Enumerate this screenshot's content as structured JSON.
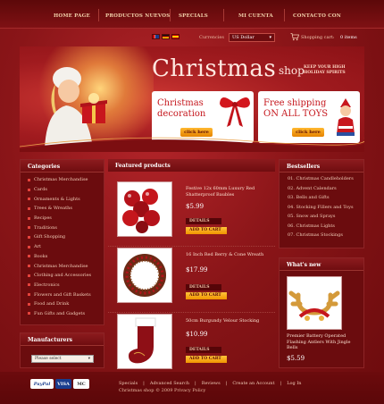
{
  "nav": [
    "HOME PAGE",
    "PRODUCTOS NUEVOS",
    "SPECIALS",
    "MI CUENTA",
    "CONTACTO CON"
  ],
  "currency": {
    "label": "Currencies",
    "value": "US Dollar"
  },
  "cart": {
    "label": "Shopping cart:",
    "items": "0 items"
  },
  "banner": {
    "title": "Christmas",
    "title_suffix": "shop",
    "tagline": "KEEP YOUR HIGH HOLIDAY SPIRITS",
    "promo1": {
      "line1": "Christmas",
      "line2": "decoration",
      "button": "click here"
    },
    "promo2": {
      "line1": "Free shipping",
      "line2": "ON ALL TOYS",
      "button": "click here"
    }
  },
  "categories": {
    "title": "Categories",
    "items": [
      "Christmas Merchandise",
      "Cards",
      "Ornaments & Lights",
      "Trees & Wreaths",
      "Recipes",
      "Traditions",
      "Gift Shopping",
      "Art",
      "Books",
      "Christmas Merchandise",
      "Clothing and Accessories",
      "Electronics",
      "Flowers and Gift Baskets",
      "Food and Drink",
      "Fun Gifts and Gadgets"
    ]
  },
  "featured": {
    "title": "Featured products",
    "products": [
      {
        "name": "Festive 12x 60mm Luxury Red Shatterproof Baubles",
        "price": "$5.99",
        "details": "DETAILS",
        "add": "ADD TO CART"
      },
      {
        "name": "16 Inch Red Berry & Cone Wreath",
        "price": "$17.99",
        "details": "DETAILS",
        "add": "ADD TO CART"
      },
      {
        "name": "50cm Burgundy Velour Stocking",
        "price": "$10.99",
        "details": "DETAILS",
        "add": "ADD TO CART"
      }
    ]
  },
  "bestsellers": {
    "title": "Bestsellers",
    "items": [
      "01. Christmas Candleholders",
      "02. Advent Calendars",
      "03. Bells and Gifts",
      "04. Stocking Fillers and Toys",
      "05. Snow and Sprays",
      "06. Christmas Lights",
      "07. Christmas Stockings"
    ]
  },
  "whats_new": {
    "title": "What's new",
    "name": "Premier Battery Operated Flashing Antlers With Jingle Bells",
    "price": "$5.59"
  },
  "manufacturers": {
    "title": "Manufacturers",
    "select": "Please select"
  },
  "footer": {
    "links": [
      "Specials",
      "Advanced Search",
      "Reviews",
      "Create an Account",
      "Log In"
    ],
    "copyright": "Christmas shop © 2009 Privacy Policy",
    "payments": [
      "PayPal",
      "VISA",
      "MC"
    ]
  }
}
